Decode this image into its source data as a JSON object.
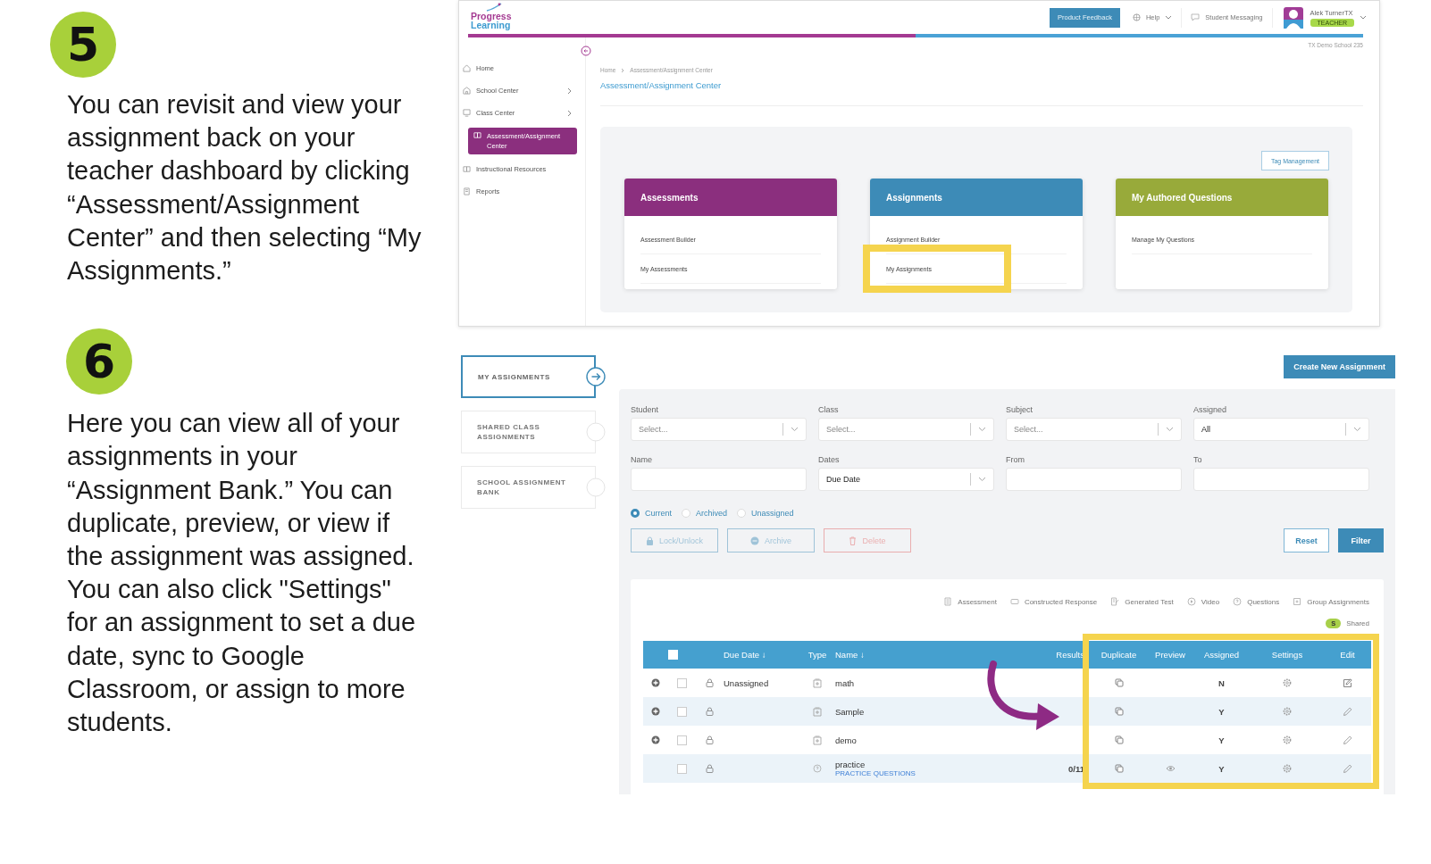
{
  "steps": [
    {
      "number": "5",
      "text": "You can revisit and view your assignment back on your teacher dashboard by clicking “Assessment/Assignment Center” and then selecting “My Assignments.”"
    },
    {
      "number": "6",
      "text": "Here you can view all of your assignments in your “Assignment Bank.” You can duplicate, preview, or view if the assignment was assigned. You can also click \"Settings\" for an assignment to set a due date, sync to Google Classroom, or assign to more students."
    }
  ],
  "dashboard": {
    "logo": [
      "Progress",
      "Learning"
    ],
    "feedback_button": "Product Feedback",
    "help": "Help",
    "messaging": "Student Messaging",
    "user": {
      "name": "Alek TurnerTX",
      "role": "TEACHER"
    },
    "loading_bar": {
      "level": 0.5
    },
    "school": "TX Demo School 235",
    "sidebar": [
      {
        "label": "Home",
        "has_submenu": false,
        "selected": false
      },
      {
        "label": "School Center",
        "has_submenu": true,
        "selected": false
      },
      {
        "label": "Class Center",
        "has_submenu": true,
        "selected": false
      },
      {
        "label": "Assessment/Assignment Center",
        "has_submenu": false,
        "selected": true
      },
      {
        "label": "Instructional Resources",
        "has_submenu": false,
        "selected": false
      },
      {
        "label": "Reports",
        "has_submenu": false,
        "selected": false
      }
    ],
    "breadcrumb": [
      "Home",
      "Assessment/Assignment Center"
    ],
    "page_title": "Assessment/Assignment Center",
    "tag_button": "Tag Management",
    "cards": [
      {
        "title": "Assessments",
        "color": "#8b2f7e",
        "links": [
          {
            "label": "Assessment Builder",
            "highlighted": false
          },
          {
            "label": "My Assessments",
            "highlighted": false
          }
        ]
      },
      {
        "title": "Assignments",
        "color": "#3d8bb7",
        "links": [
          {
            "label": "Assignment Builder",
            "highlighted": false
          },
          {
            "label": "My Assignments",
            "highlighted": true
          }
        ]
      },
      {
        "title": "My Authored Questions",
        "color": "#98aa3a",
        "links": [
          {
            "label": "Manage My Questions",
            "highlighted": false
          }
        ]
      }
    ]
  },
  "assignments": {
    "tabs": [
      {
        "label": "MY ASSIGNMENTS",
        "selected": true
      },
      {
        "label": "SHARED CLASS ASSIGNMENTS",
        "selected": false
      },
      {
        "label": "SCHOOL ASSIGNMENT BANK",
        "selected": false
      }
    ],
    "create_button": "Create New Assignment",
    "filters": [
      {
        "label": "Student",
        "kind": "select",
        "placeholder": "Select..."
      },
      {
        "label": "Class",
        "kind": "select",
        "placeholder": "Select..."
      },
      {
        "label": "Subject",
        "kind": "select",
        "placeholder": "Select..."
      },
      {
        "label": "Assigned",
        "kind": "select",
        "value": "All"
      },
      {
        "label": "Name",
        "kind": "text"
      },
      {
        "label": "Dates",
        "kind": "select",
        "value": "Due Date"
      },
      {
        "label": "From",
        "kind": "text"
      },
      {
        "label": "To",
        "kind": "text"
      }
    ],
    "status_options": [
      {
        "label": "Current",
        "selected": true
      },
      {
        "label": "Archived",
        "selected": false
      },
      {
        "label": "Unassigned",
        "selected": false
      }
    ],
    "action_buttons": [
      {
        "label": "Lock/Unlock",
        "kind": "lock",
        "disabled": true
      },
      {
        "label": "Archive",
        "kind": "archive",
        "disabled": true
      },
      {
        "label": "Delete",
        "kind": "delete",
        "disabled": true
      }
    ],
    "reset_button": "Reset",
    "filter_button": "Filter",
    "legend": [
      "Assessment",
      "Constructed Response",
      "Generated Test",
      "Video",
      "Questions",
      "Group Assignments"
    ],
    "shared_badge": {
      "letter": "S",
      "label": "Shared"
    },
    "columns": [
      {
        "label": "Due Date ↓",
        "highlighted": false
      },
      {
        "label": "Type",
        "highlighted": false
      },
      {
        "label": "Name ↓",
        "highlighted": false
      },
      {
        "label": "Results",
        "highlighted": false
      },
      {
        "label": "Duplicate",
        "highlighted": true
      },
      {
        "label": "Preview",
        "highlighted": true
      },
      {
        "label": "Assigned",
        "highlighted": true
      },
      {
        "label": "Settings",
        "highlighted": true
      },
      {
        "label": "Edit",
        "highlighted": true
      }
    ],
    "header_checked": false,
    "rows": [
      {
        "kind": "group",
        "expandable": true,
        "checked": false,
        "due_date": "Unassigned",
        "name": "math",
        "preview": false,
        "assigned": "N",
        "edit_boxed": true
      },
      {
        "kind": "group",
        "expandable": true,
        "checked": false,
        "name": "Sample",
        "preview": false,
        "assigned": "Y",
        "edit_boxed": false
      },
      {
        "kind": "group",
        "expandable": true,
        "checked": false,
        "name": "demo",
        "preview": false,
        "assigned": "Y",
        "edit_boxed": false
      },
      {
        "kind": "questions",
        "expandable": false,
        "checked": false,
        "name": "practice",
        "subtitle": "PRACTICE QUESTIONS",
        "results": "0/11",
        "preview": true,
        "assigned": "Y",
        "edit_boxed": false
      }
    ]
  }
}
